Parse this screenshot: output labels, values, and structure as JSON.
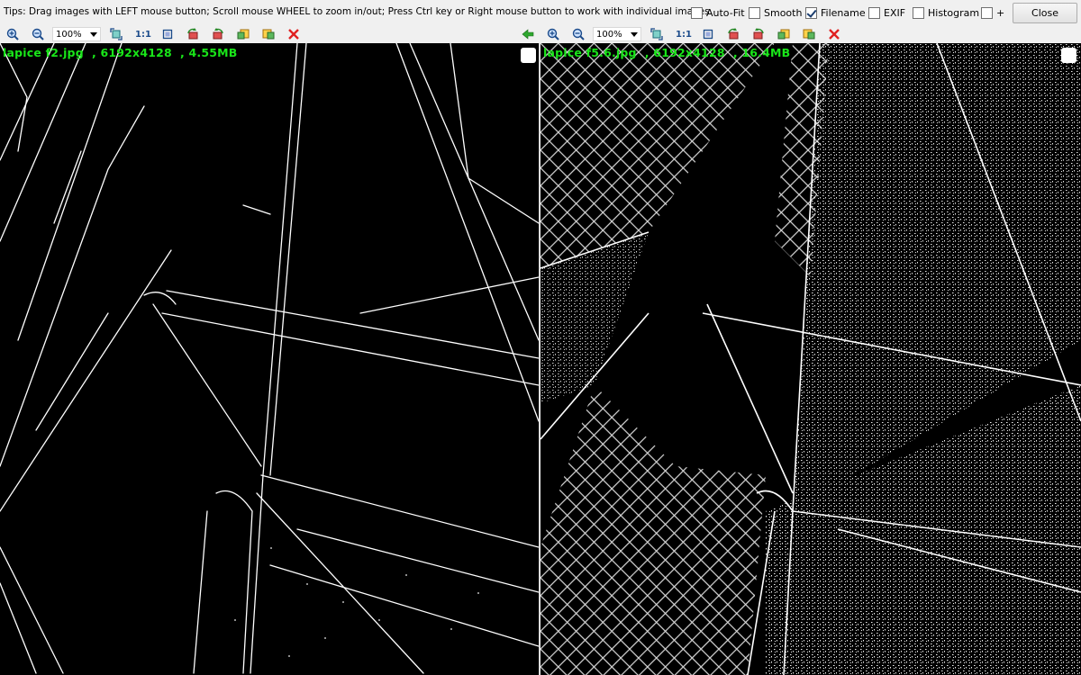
{
  "tips": "Tips: Drag images with LEFT mouse button; Scroll mouse WHEEL to zoom in/out; Press Ctrl key or Right mouse button to work with individual images.",
  "options": {
    "autofit": {
      "label": "Auto-Fit",
      "checked": false
    },
    "smooth": {
      "label": "Smooth",
      "checked": false
    },
    "filename": {
      "label": "Filename",
      "checked": true
    },
    "exif": {
      "label": "EXIF",
      "checked": false
    },
    "histogram": {
      "label": "Histogram",
      "checked": false
    },
    "plus": {
      "label": "+",
      "checked": false
    }
  },
  "close_label": "Close",
  "left_pane": {
    "zoom": "100%",
    "one_to_one": "1:1",
    "filename_overlay": "lapice f2.jpg  , 6192x4128  , 4.55MB"
  },
  "right_pane": {
    "zoom": "100%",
    "one_to_one": "1:1",
    "filename_overlay": "lapice f5.6.jpg  , 6192x4128  , 16.4MB"
  },
  "icons": [
    "zoom-in-icon",
    "zoom-out-icon",
    "fit-width-icon",
    "fit-window-icon",
    "rotate-left-icon",
    "rotate-right-icon",
    "previous-image-icon",
    "next-image-icon",
    "close-image-icon",
    "sync-arrow-icon"
  ],
  "colors": {
    "overlay_text": "#19e619",
    "background": "#000000",
    "edges": "#ffffff",
    "close_x": "#e02020"
  }
}
